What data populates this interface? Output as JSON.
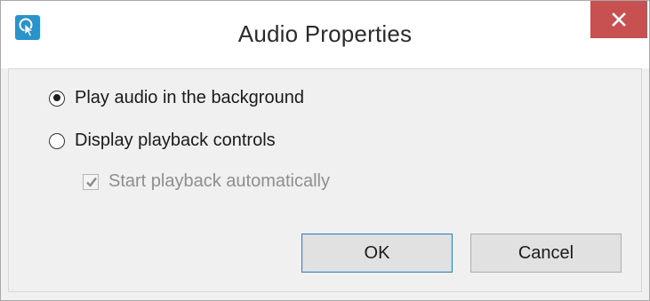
{
  "window": {
    "title": "Audio Properties",
    "app_icon": "touch-hand-icon",
    "close_icon": "close-icon",
    "close_color": "#c75050"
  },
  "options": [
    {
      "label": "Play audio in the background",
      "selected": true
    },
    {
      "label": "Display playback controls",
      "selected": false
    }
  ],
  "autoplay": {
    "label": "Start playback automatically",
    "checked": true,
    "enabled": false
  },
  "buttons": {
    "ok": "OK",
    "cancel": "Cancel"
  }
}
